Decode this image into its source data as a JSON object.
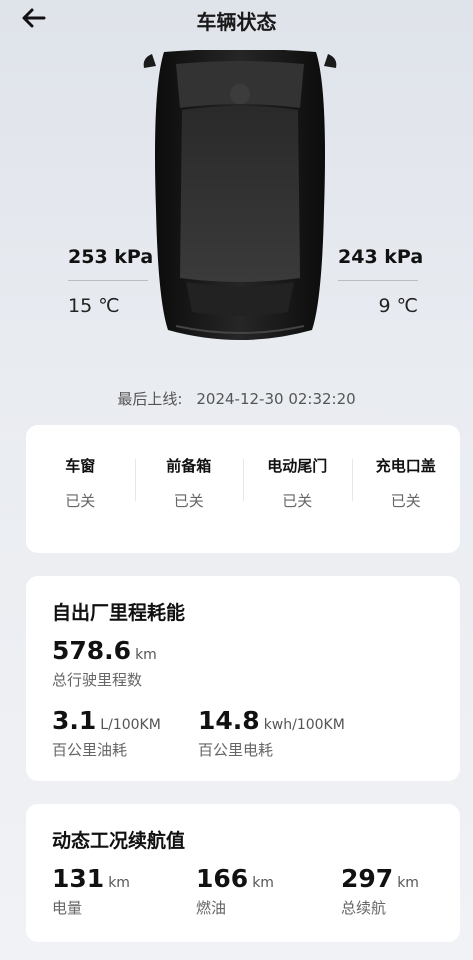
{
  "header": {
    "title": "车辆状态",
    "back_icon": "arrow-left-icon"
  },
  "tires": {
    "front_left": {
      "pressure": "253 kPa",
      "temperature": "15 ℃"
    },
    "front_right": {
      "pressure": "243 kPa",
      "temperature": "9 ℃"
    }
  },
  "last_online": {
    "label": "最后上线:",
    "value": "2024-12-30 02:32:20"
  },
  "status": [
    {
      "label": "车窗",
      "value": "已关"
    },
    {
      "label": "前备箱",
      "value": "已关"
    },
    {
      "label": "电动尾门",
      "value": "已关"
    },
    {
      "label": "充电口盖",
      "value": "已关"
    }
  ],
  "mileage": {
    "title": "自出厂里程耗能",
    "total": {
      "value": "578.6",
      "unit": "km",
      "label": "总行驶里程数"
    },
    "fuel": {
      "value": "3.1",
      "unit": "L/100KM",
      "label": "百公里油耗"
    },
    "power": {
      "value": "14.8",
      "unit": "kwh/100KM",
      "label": "百公里电耗"
    }
  },
  "range": {
    "title": "动态工况续航值",
    "electric": {
      "value": "131",
      "unit": "km",
      "label": "电量"
    },
    "fuel": {
      "value": "166",
      "unit": "km",
      "label": "燃油"
    },
    "total": {
      "value": "297",
      "unit": "km",
      "label": "总续航"
    }
  },
  "colors": {
    "background": "#e9ecf1",
    "card": "#ffffff",
    "car_body": "#161616"
  }
}
